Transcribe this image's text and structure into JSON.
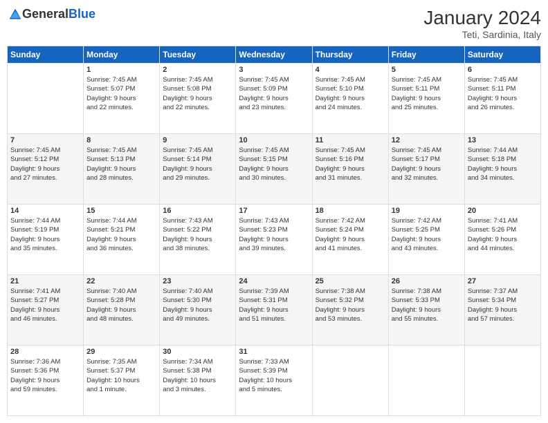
{
  "header": {
    "logo_general": "General",
    "logo_blue": "Blue",
    "month": "January 2024",
    "location": "Teti, Sardinia, Italy"
  },
  "weekdays": [
    "Sunday",
    "Monday",
    "Tuesday",
    "Wednesday",
    "Thursday",
    "Friday",
    "Saturday"
  ],
  "weeks": [
    [
      {
        "day": "",
        "info": ""
      },
      {
        "day": "1",
        "info": "Sunrise: 7:45 AM\nSunset: 5:07 PM\nDaylight: 9 hours\nand 22 minutes."
      },
      {
        "day": "2",
        "info": "Sunrise: 7:45 AM\nSunset: 5:08 PM\nDaylight: 9 hours\nand 22 minutes."
      },
      {
        "day": "3",
        "info": "Sunrise: 7:45 AM\nSunset: 5:09 PM\nDaylight: 9 hours\nand 23 minutes."
      },
      {
        "day": "4",
        "info": "Sunrise: 7:45 AM\nSunset: 5:10 PM\nDaylight: 9 hours\nand 24 minutes."
      },
      {
        "day": "5",
        "info": "Sunrise: 7:45 AM\nSunset: 5:11 PM\nDaylight: 9 hours\nand 25 minutes."
      },
      {
        "day": "6",
        "info": "Sunrise: 7:45 AM\nSunset: 5:11 PM\nDaylight: 9 hours\nand 26 minutes."
      }
    ],
    [
      {
        "day": "7",
        "info": "Sunrise: 7:45 AM\nSunset: 5:12 PM\nDaylight: 9 hours\nand 27 minutes."
      },
      {
        "day": "8",
        "info": "Sunrise: 7:45 AM\nSunset: 5:13 PM\nDaylight: 9 hours\nand 28 minutes."
      },
      {
        "day": "9",
        "info": "Sunrise: 7:45 AM\nSunset: 5:14 PM\nDaylight: 9 hours\nand 29 minutes."
      },
      {
        "day": "10",
        "info": "Sunrise: 7:45 AM\nSunset: 5:15 PM\nDaylight: 9 hours\nand 30 minutes."
      },
      {
        "day": "11",
        "info": "Sunrise: 7:45 AM\nSunset: 5:16 PM\nDaylight: 9 hours\nand 31 minutes."
      },
      {
        "day": "12",
        "info": "Sunrise: 7:45 AM\nSunset: 5:17 PM\nDaylight: 9 hours\nand 32 minutes."
      },
      {
        "day": "13",
        "info": "Sunrise: 7:44 AM\nSunset: 5:18 PM\nDaylight: 9 hours\nand 34 minutes."
      }
    ],
    [
      {
        "day": "14",
        "info": "Sunrise: 7:44 AM\nSunset: 5:19 PM\nDaylight: 9 hours\nand 35 minutes."
      },
      {
        "day": "15",
        "info": "Sunrise: 7:44 AM\nSunset: 5:21 PM\nDaylight: 9 hours\nand 36 minutes."
      },
      {
        "day": "16",
        "info": "Sunrise: 7:43 AM\nSunset: 5:22 PM\nDaylight: 9 hours\nand 38 minutes."
      },
      {
        "day": "17",
        "info": "Sunrise: 7:43 AM\nSunset: 5:23 PM\nDaylight: 9 hours\nand 39 minutes."
      },
      {
        "day": "18",
        "info": "Sunrise: 7:42 AM\nSunset: 5:24 PM\nDaylight: 9 hours\nand 41 minutes."
      },
      {
        "day": "19",
        "info": "Sunrise: 7:42 AM\nSunset: 5:25 PM\nDaylight: 9 hours\nand 43 minutes."
      },
      {
        "day": "20",
        "info": "Sunrise: 7:41 AM\nSunset: 5:26 PM\nDaylight: 9 hours\nand 44 minutes."
      }
    ],
    [
      {
        "day": "21",
        "info": "Sunrise: 7:41 AM\nSunset: 5:27 PM\nDaylight: 9 hours\nand 46 minutes."
      },
      {
        "day": "22",
        "info": "Sunrise: 7:40 AM\nSunset: 5:28 PM\nDaylight: 9 hours\nand 48 minutes."
      },
      {
        "day": "23",
        "info": "Sunrise: 7:40 AM\nSunset: 5:30 PM\nDaylight: 9 hours\nand 49 minutes."
      },
      {
        "day": "24",
        "info": "Sunrise: 7:39 AM\nSunset: 5:31 PM\nDaylight: 9 hours\nand 51 minutes."
      },
      {
        "day": "25",
        "info": "Sunrise: 7:38 AM\nSunset: 5:32 PM\nDaylight: 9 hours\nand 53 minutes."
      },
      {
        "day": "26",
        "info": "Sunrise: 7:38 AM\nSunset: 5:33 PM\nDaylight: 9 hours\nand 55 minutes."
      },
      {
        "day": "27",
        "info": "Sunrise: 7:37 AM\nSunset: 5:34 PM\nDaylight: 9 hours\nand 57 minutes."
      }
    ],
    [
      {
        "day": "28",
        "info": "Sunrise: 7:36 AM\nSunset: 5:36 PM\nDaylight: 9 hours\nand 59 minutes."
      },
      {
        "day": "29",
        "info": "Sunrise: 7:35 AM\nSunset: 5:37 PM\nDaylight: 10 hours\nand 1 minute."
      },
      {
        "day": "30",
        "info": "Sunrise: 7:34 AM\nSunset: 5:38 PM\nDaylight: 10 hours\nand 3 minutes."
      },
      {
        "day": "31",
        "info": "Sunrise: 7:33 AM\nSunset: 5:39 PM\nDaylight: 10 hours\nand 5 minutes."
      },
      {
        "day": "",
        "info": ""
      },
      {
        "day": "",
        "info": ""
      },
      {
        "day": "",
        "info": ""
      }
    ]
  ]
}
